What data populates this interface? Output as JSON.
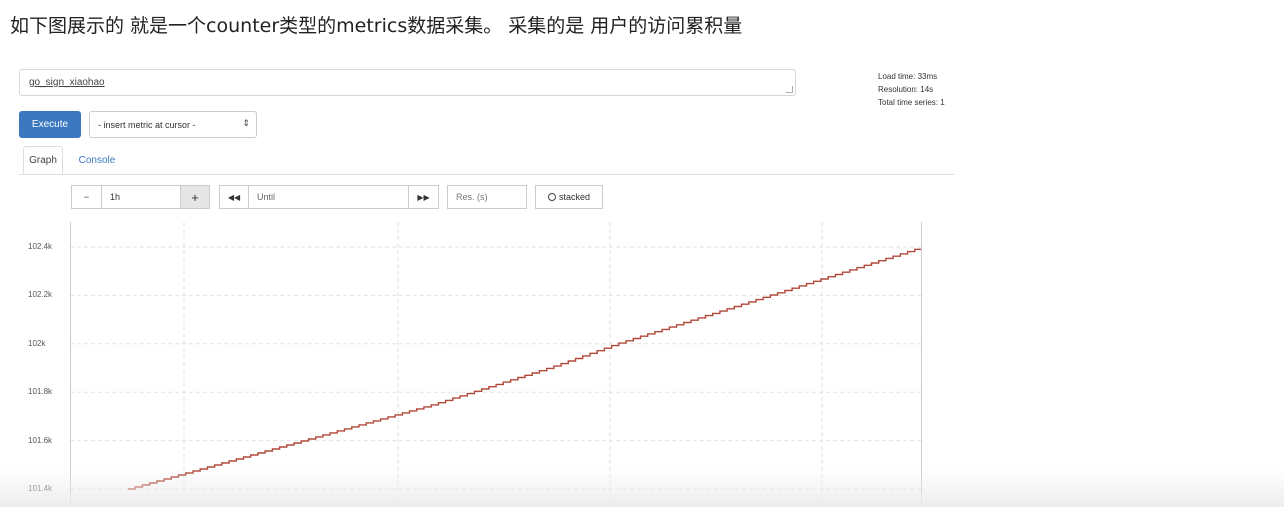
{
  "caption": "如下图展示的 就是一个counter类型的metrics数据采集。 采集的是 用户的访问累积量",
  "expression": {
    "value": "go_sign_xiaohao"
  },
  "stats": [
    "Load time: 33ms",
    "Resolution: 14s",
    "Total time series: 1"
  ],
  "execute_label": "Execute",
  "insert_metric_label": "- insert metric at cursor -",
  "tabs": {
    "graph": "Graph",
    "console": "Console"
  },
  "controls": {
    "minus": "−",
    "range": "1h",
    "plus": "+",
    "back": "◀◀",
    "until_placeholder": "Until",
    "forward": "▶▶",
    "res_placeholder": "Res. (s)",
    "stacked_label": "stacked"
  },
  "colors": {
    "accent": "#3b78c0",
    "series": "#b2483a"
  },
  "chart_data": {
    "type": "line",
    "ylim": [
      101400,
      102500
    ],
    "yticks": [
      101400,
      101600,
      101800,
      102000,
      102200,
      102400
    ],
    "ytick_labels": [
      "101.4k",
      "101.6k",
      "101.8k",
      "102k",
      "102.2k",
      "102.4k"
    ],
    "grid": true,
    "series": [
      {
        "values": [
          101400,
          101470,
          101540,
          101610,
          101680,
          101750,
          101830,
          101910,
          102000,
          102080,
          102160,
          102240,
          102320,
          102400
        ]
      }
    ]
  }
}
